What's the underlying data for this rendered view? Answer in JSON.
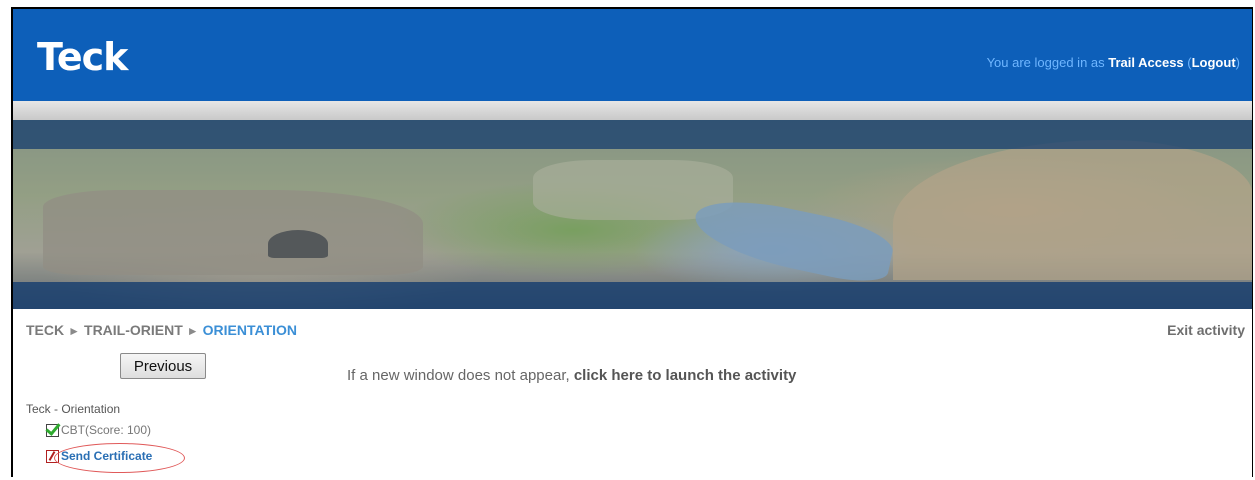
{
  "header": {
    "logo": "Teck",
    "login_prefix": "You are logged in as ",
    "user": "Trail Access",
    "logout_open": " (",
    "logout": "Logout",
    "logout_close": ")"
  },
  "breadcrumb": {
    "items": [
      "TECK",
      "TRAIL-ORIENT",
      "ORIENTATION"
    ],
    "separator": "►"
  },
  "exit_label": "Exit activity",
  "previous_label": "Previous",
  "launch": {
    "prefix": "If a new window does not appear, ",
    "link": "click here to launch the activity"
  },
  "toc": {
    "title": "Teck - Orientation",
    "items": [
      {
        "label": "CBT(Score: 100)",
        "status": "complete"
      },
      {
        "label": "Send Certificate",
        "status": "incomplete"
      }
    ]
  },
  "colors": {
    "header_bg": "#0d5fb9",
    "breadcrumb_current": "#3b8fd6",
    "link": "#2a6fb4",
    "highlight": "#e05a5a"
  }
}
